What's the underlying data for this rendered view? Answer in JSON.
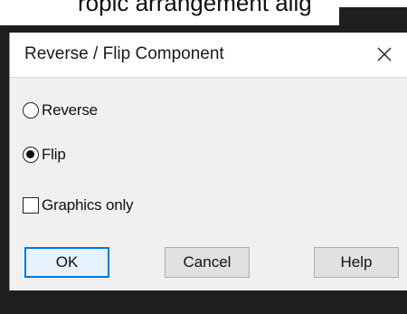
{
  "background": {
    "clipped_text": "ropic arrangement alig"
  },
  "dialog": {
    "title": "Reverse / Flip Component",
    "close_icon": "close-x-icon",
    "options": [
      {
        "label": "Reverse",
        "type": "radio",
        "checked": false
      },
      {
        "label": "Flip",
        "type": "radio",
        "checked": true
      }
    ],
    "graphics_only": {
      "label": "Graphics only",
      "checked": false
    },
    "buttons": {
      "ok": "OK",
      "cancel": "Cancel",
      "help": "Help"
    }
  },
  "colors": {
    "accent": "#0078d7",
    "dialog_bg": "#f0f0f0",
    "frame_bg": "#1e1e1e"
  }
}
